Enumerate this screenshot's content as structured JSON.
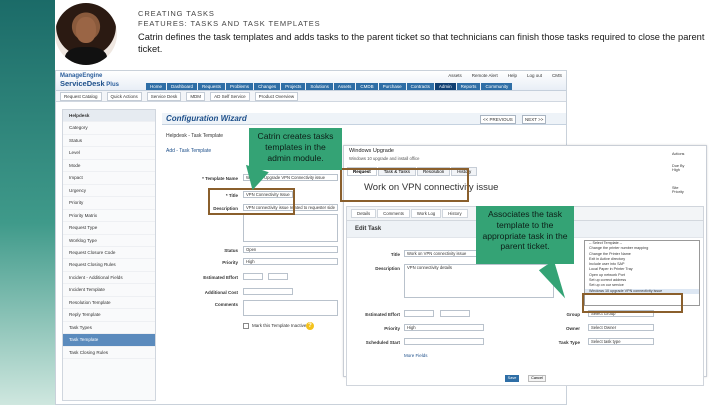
{
  "slide": {
    "kicker_line1": "CREATING TASKS",
    "kicker_line2": "FEATURES: TASKS AND TASK TEMPLATES",
    "description": "Catrin defines the task templates and adds tasks to the parent ticket so that technicians can finish those tasks required to close the parent ticket."
  },
  "app": {
    "logo_top": "ManageEngine",
    "logo_main": "ServiceDesk",
    "logo_suffix": "Plus",
    "nav": [
      "Home",
      "Dashboard",
      "Requests",
      "Problems",
      "Changes",
      "Projects",
      "Solutions",
      "Assets",
      "CMDB",
      "Purchase",
      "Contracts",
      "Admin",
      "Reports",
      "Community"
    ],
    "active_nav": "Admin",
    "top_links": [
      "Assets",
      "Remote Alert",
      "Help",
      "Log out",
      "CMS"
    ],
    "subbar": [
      "Request Catalog",
      "Quick Actions",
      "Service Desk",
      "MDM",
      "AD Self Service",
      "Product Overview"
    ]
  },
  "tree": {
    "header": "Helpdesk",
    "items": [
      "Category",
      "Status",
      "Level",
      "Mode",
      "Impact",
      "Urgency",
      "Priority",
      "Priority Matrix",
      "Request Type",
      "Worklog Type",
      "Request Closure Code",
      "Request Closing Rules",
      "Incident - Additional Fields",
      "Incident Template",
      "Resolution Template",
      "Reply Template",
      "Task Types",
      "Task Template",
      "Task Closing Rules"
    ],
    "selected": "Task Template"
  },
  "wizard": {
    "title": "Configuration Wizard",
    "prev": "<< PREVIOUS",
    "next": "NEXT >>",
    "breadcrumb": "Helpdesk - Task Template",
    "subcrumb": "Add - Task Template"
  },
  "form": {
    "template_name_label": "* Template Name",
    "template_name_value": "Windows Upgrade VPN Connectivity issue",
    "title_label": "* Title",
    "title_value": "VPN Connectivity Issue",
    "description_label": "Description",
    "description_value": "VPN connectivity issue related to requester side",
    "status_label": "Status",
    "status_value": "Open",
    "priority_label": "Priority",
    "priority_value": "High",
    "estimated_effort_label": "Estimated Effort",
    "additional_cost_label": "Additional Cost",
    "comments_label": "Comments",
    "inactive_checkbox": "Mark this Template Inactive"
  },
  "window": {
    "title": "Windows Upgrade",
    "subtitle": "Windows 10 upgrade and install office",
    "tabs": [
      "Request",
      "Task & Tasks",
      "Resolution",
      "History"
    ],
    "task_heading": "Work on VPN connectivity issue",
    "side_items": [
      "Actions",
      "Due By",
      "High",
      "Site",
      "Priority"
    ]
  },
  "task_dialog": {
    "tabs": [
      "Details",
      "Comments",
      "Work Log",
      "History"
    ],
    "title": "Edit Task",
    "title_label": "Title",
    "title_value": "Work on VPN connectivity issue",
    "desc_label": "Description",
    "desc_value": "VPN connectivity details",
    "est_label": "Estimated Effort",
    "priority_label": "Priority",
    "priority_value": "High",
    "sched_label": "Scheduled Start",
    "group_label": "Group",
    "group_value": "Select Group",
    "owner_label": "Owner",
    "owner_value": "Select Owner",
    "type_label": "Task Type",
    "type_value": "Select task type",
    "more_label": "More Fields",
    "save": "Save",
    "cancel": "Cancel"
  },
  "dropdown": {
    "options": [
      "-- Select Template --",
      "Change the printer number mapping",
      "Change the Printer Name",
      "Exit in Active directory",
      "Include user into SAP",
      "Local Paper in Printer Tray",
      "Open up network Port",
      "Set up correct address",
      "Set up on our service",
      "Windows 10 upgrade VPN connectivity issue"
    ],
    "highlighted": "Windows 10 upgrade VPN connectivity issue"
  },
  "callouts": {
    "one": "Catrin creates tasks templates in the admin module.",
    "two": "Associates the task template to the appropriate task in the parent ticket."
  },
  "colors": {
    "callout": "#34a375",
    "highlight_border": "#8a5f2c",
    "nav_blue": "#2e6ea6"
  }
}
